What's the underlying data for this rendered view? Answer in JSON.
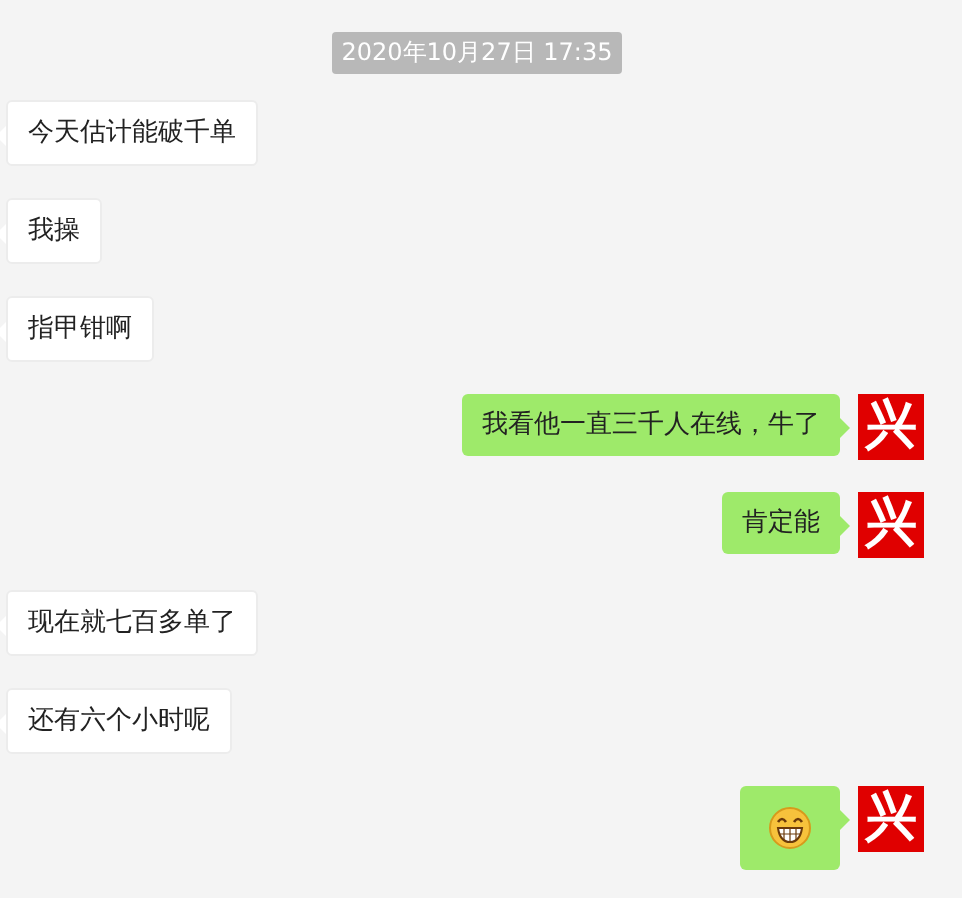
{
  "timestamp": "2020年10月27日 17:35",
  "messages": [
    {
      "outgoing": false,
      "kind": "text",
      "text": "今天估计能破千单"
    },
    {
      "outgoing": false,
      "kind": "text",
      "text": "我操"
    },
    {
      "outgoing": false,
      "kind": "text",
      "text": "指甲钳啊"
    },
    {
      "outgoing": true,
      "kind": "text",
      "text": "我看他一直三千人在线，牛了",
      "avatar": "兴"
    },
    {
      "outgoing": true,
      "kind": "text",
      "text": "肯定能",
      "avatar": "兴"
    },
    {
      "outgoing": false,
      "kind": "text",
      "text": "现在就七百多单了"
    },
    {
      "outgoing": false,
      "kind": "text",
      "text": "还有六个小时呢"
    },
    {
      "outgoing": true,
      "kind": "emoji",
      "avatar": "兴"
    }
  ]
}
